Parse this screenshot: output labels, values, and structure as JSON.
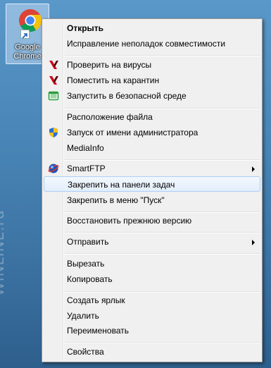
{
  "desktop": {
    "shortcut_label": "Google\nChrome",
    "watermark": "WINLINE.ru"
  },
  "menu": {
    "items": [
      {
        "label": "Открыть",
        "bold": true
      },
      {
        "label": "Исправление неполадок совместимости"
      },
      {
        "label": "Проверить на вирусы",
        "icon": "kaspersky-icon"
      },
      {
        "label": "Поместить на карантин",
        "icon": "kaspersky-icon"
      },
      {
        "label": "Запустить в безопасной среде",
        "icon": "safe-run-icon"
      },
      {
        "label": "Расположение файла"
      },
      {
        "label": "Запуск от имени администратора",
        "icon": "uac-shield-icon"
      },
      {
        "label": "MediaInfo"
      },
      {
        "label": "SmartFTP",
        "icon": "smartftp-icon",
        "submenu": true
      },
      {
        "label": "Закрепить на панели задач",
        "highlighted": true
      },
      {
        "label": "Закрепить в меню \"Пуск\""
      },
      {
        "label": "Восстановить прежнюю версию"
      },
      {
        "label": "Отправить",
        "submenu": true
      },
      {
        "label": "Вырезать"
      },
      {
        "label": "Копировать"
      },
      {
        "label": "Создать ярлык"
      },
      {
        "label": "Удалить"
      },
      {
        "label": "Переименовать"
      },
      {
        "label": "Свойства"
      }
    ]
  },
  "colors": {
    "menu_bg": "#f0f0f0",
    "highlight_border": "#aecff7",
    "desktop_bg": "#4a87b8"
  }
}
